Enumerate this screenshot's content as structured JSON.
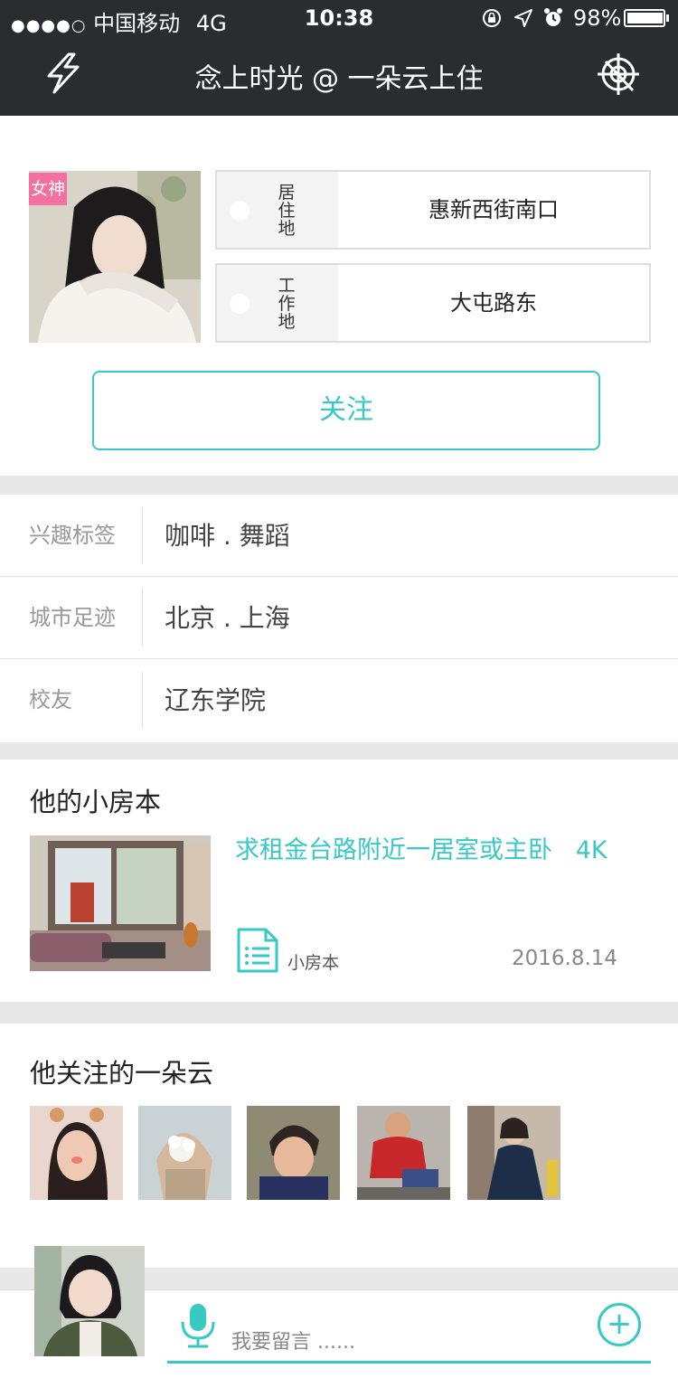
{
  "status_bar": {
    "signal": "●●●●○",
    "carrier": "中国移动",
    "network": "4G",
    "time": "10:38",
    "battery": "98%",
    "battery_level": 0.98
  },
  "nav": {
    "title": "念上时光 @ 一朵云上住",
    "left_icon": "lightning-icon",
    "right_icon": "target-icon"
  },
  "profile": {
    "badge": "女神",
    "residence_label": "居住地",
    "residence_value": "惠新西街南口",
    "work_label": "工作地",
    "work_value": "大屯路东",
    "follow_button": "关注"
  },
  "info": [
    {
      "key": "兴趣标签",
      "value": "咖啡 . 舞蹈"
    },
    {
      "key": "城市足迹",
      "value": "北京 . 上海"
    },
    {
      "key": "校友",
      "value": "辽东学院"
    }
  ],
  "house_note": {
    "section_title": "他的小房本",
    "post_title": "求租金台路附近一居室或主卧   4K",
    "tag": "小房本",
    "date": "2016.8.14"
  },
  "following": {
    "section_title": "他关注的一朵云"
  },
  "bottom": {
    "input_placeholder": "我要留言 ......",
    "plus": "+"
  },
  "colors": {
    "accent": "#38c9c5",
    "nav_bg": "#2b2c30",
    "badge": "#f46fa2"
  }
}
